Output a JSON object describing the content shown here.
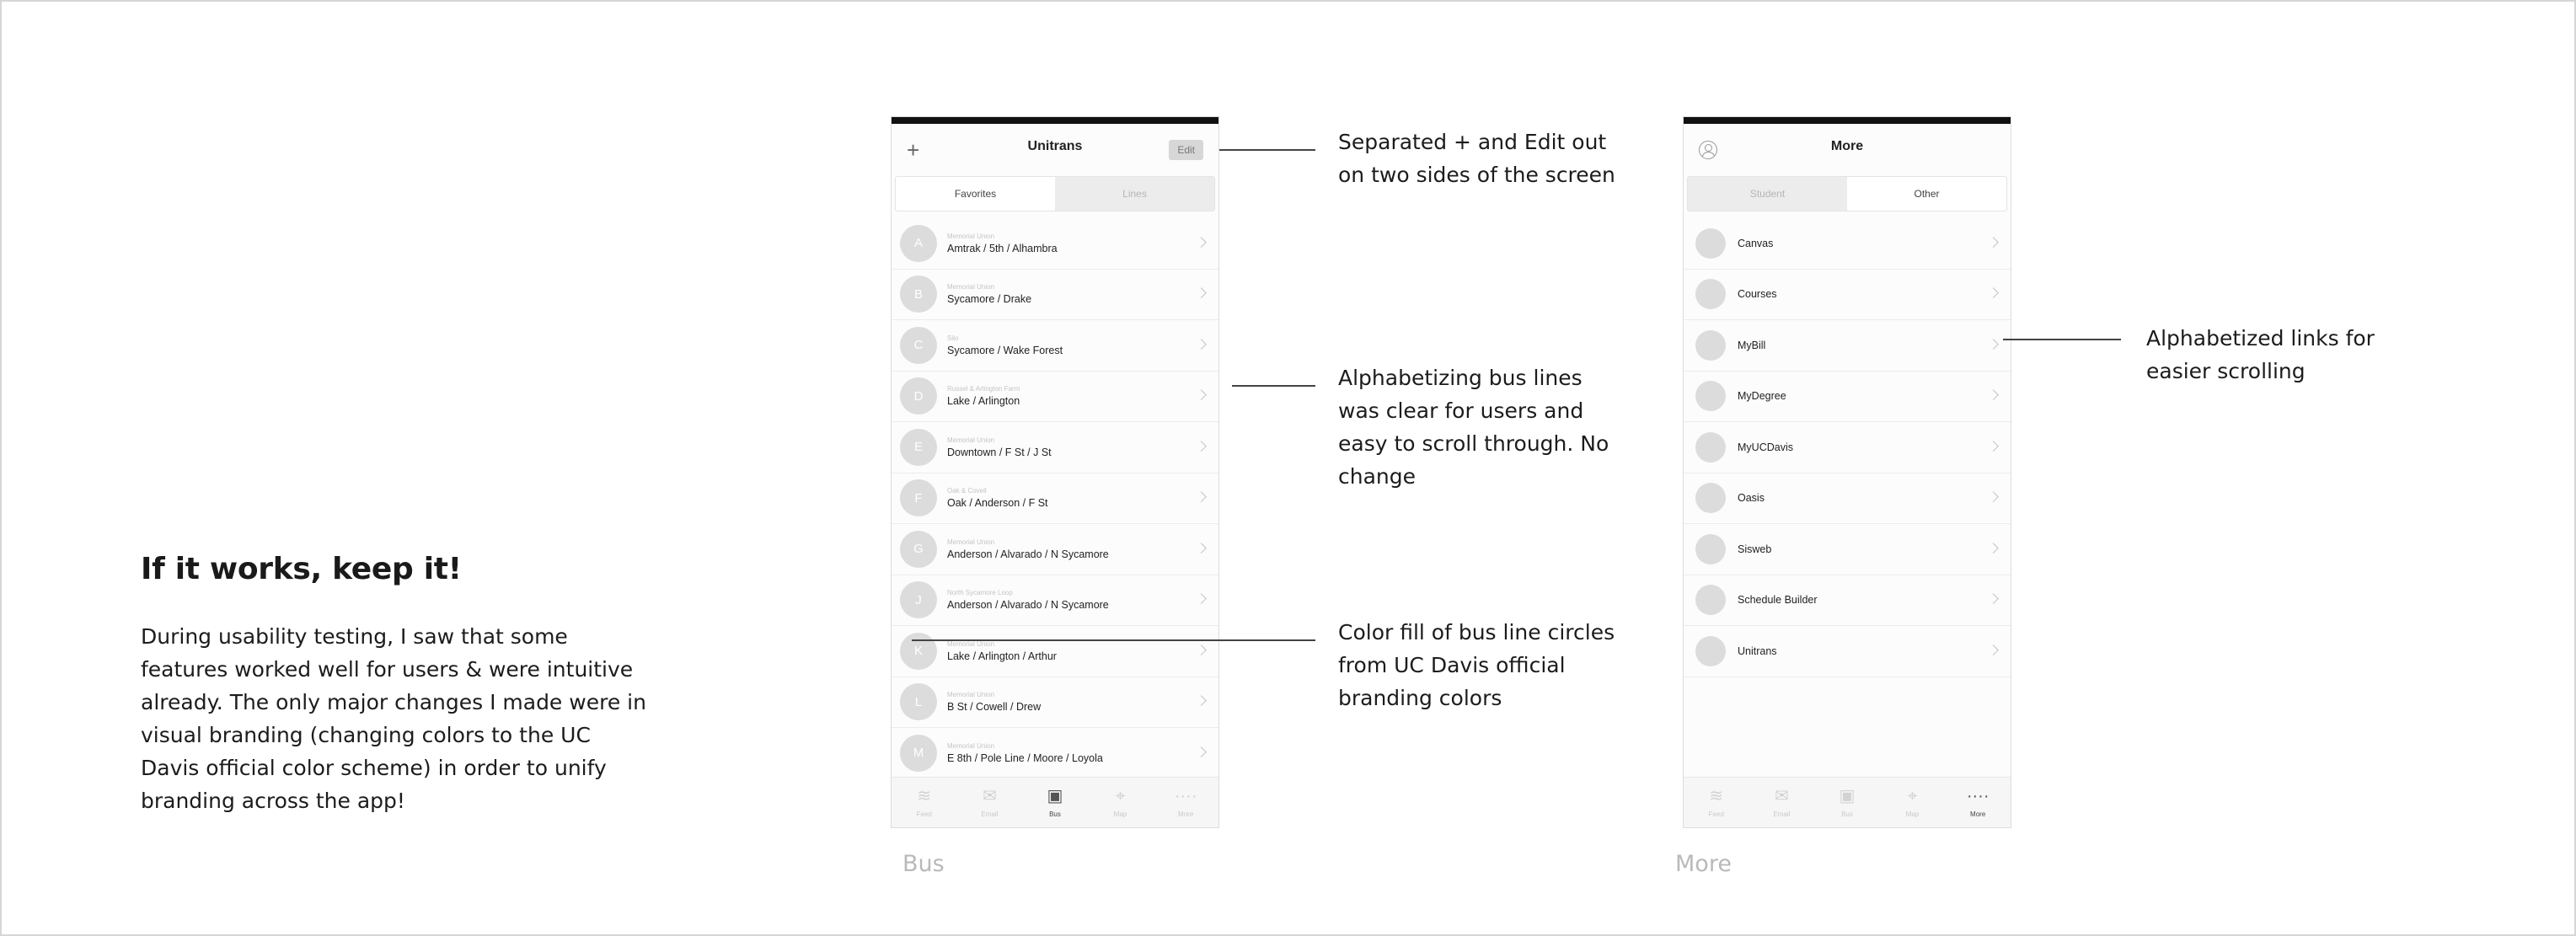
{
  "left": {
    "heading": "If it works, keep it!",
    "body": "During usability testing, I saw that some features worked well for users & were intuitive already. The only major changes I made were in visual branding (changing colors to the UC Davis official color scheme) in order to unify branding across the app!"
  },
  "bus_screen": {
    "title": "Unitrans",
    "plus": "+",
    "edit_label": "Edit",
    "segments": [
      "Favorites",
      "Lines"
    ],
    "active_segment": "Favorites",
    "rows": [
      {
        "letter": "A",
        "sub": "Memorial Union",
        "main": "Amtrak / 5th / Alhambra"
      },
      {
        "letter": "B",
        "sub": "Memorial Union",
        "main": "Sycamore / Drake"
      },
      {
        "letter": "C",
        "sub": "Silo",
        "main": "Sycamore / Wake Forest"
      },
      {
        "letter": "D",
        "sub": "Russel & Arlington Farm",
        "main": "Lake / Arlington"
      },
      {
        "letter": "E",
        "sub": "Memorial Union",
        "main": "Downtown / F St / J St"
      },
      {
        "letter": "F",
        "sub": "Oak & Covell",
        "main": "Oak / Anderson / F St"
      },
      {
        "letter": "G",
        "sub": "Memorial Union",
        "main": "Anderson / Alvarado / N Sycamore"
      },
      {
        "letter": "J",
        "sub": "North Sycamore Loop",
        "main": "Anderson / Alvarado / N Sycamore"
      },
      {
        "letter": "K",
        "sub": "Memorial Union",
        "main": "Lake / Arlington / Arthur"
      },
      {
        "letter": "L",
        "sub": "Memorial Union",
        "main": "B St / Cowell / Drew"
      },
      {
        "letter": "M",
        "sub": "Memorial Union",
        "main": "E 8th / Pole Line / Moore / Loyola"
      }
    ],
    "tabs": [
      {
        "icon": "feed-icon",
        "glyph": "≋",
        "label": "Feed"
      },
      {
        "icon": "email-icon",
        "glyph": "✉",
        "label": "Email"
      },
      {
        "icon": "bus-icon",
        "glyph": "▣",
        "label": "Bus"
      },
      {
        "icon": "map-icon",
        "glyph": "⌖",
        "label": "Map"
      },
      {
        "icon": "more-icon",
        "glyph": "····",
        "label": "More"
      }
    ],
    "active_tab": "Bus",
    "caption": "Bus"
  },
  "more_screen": {
    "title": "More",
    "segments": [
      "Student",
      "Other"
    ],
    "active_segment": "Other",
    "rows": [
      "Canvas",
      "Courses",
      "MyBill",
      "MyDegree",
      "MyUCDavis",
      "Oasis",
      "Sisweb",
      "Schedule Builder",
      "Unitrans"
    ],
    "tabs": [
      {
        "icon": "feed-icon",
        "glyph": "≋",
        "label": "Feed"
      },
      {
        "icon": "email-icon",
        "glyph": "✉",
        "label": "Email"
      },
      {
        "icon": "bus-icon",
        "glyph": "▣",
        "label": "Bus"
      },
      {
        "icon": "map-icon",
        "glyph": "⌖",
        "label": "Map"
      },
      {
        "icon": "more-icon",
        "glyph": "····",
        "label": "More"
      }
    ],
    "active_tab": "More",
    "caption": "More"
  },
  "annotations": [
    {
      "id": "edit",
      "text": "Separated + and Edit out on two sides of the screen"
    },
    {
      "id": "alpha",
      "text": "Alphabetizing bus lines was clear for users and easy to scroll through. No change"
    },
    {
      "id": "color",
      "text": "Color fill of bus line circles from UC Davis official branding colors"
    },
    {
      "id": "links",
      "text": "Alphabetized links for easier scrolling"
    }
  ]
}
